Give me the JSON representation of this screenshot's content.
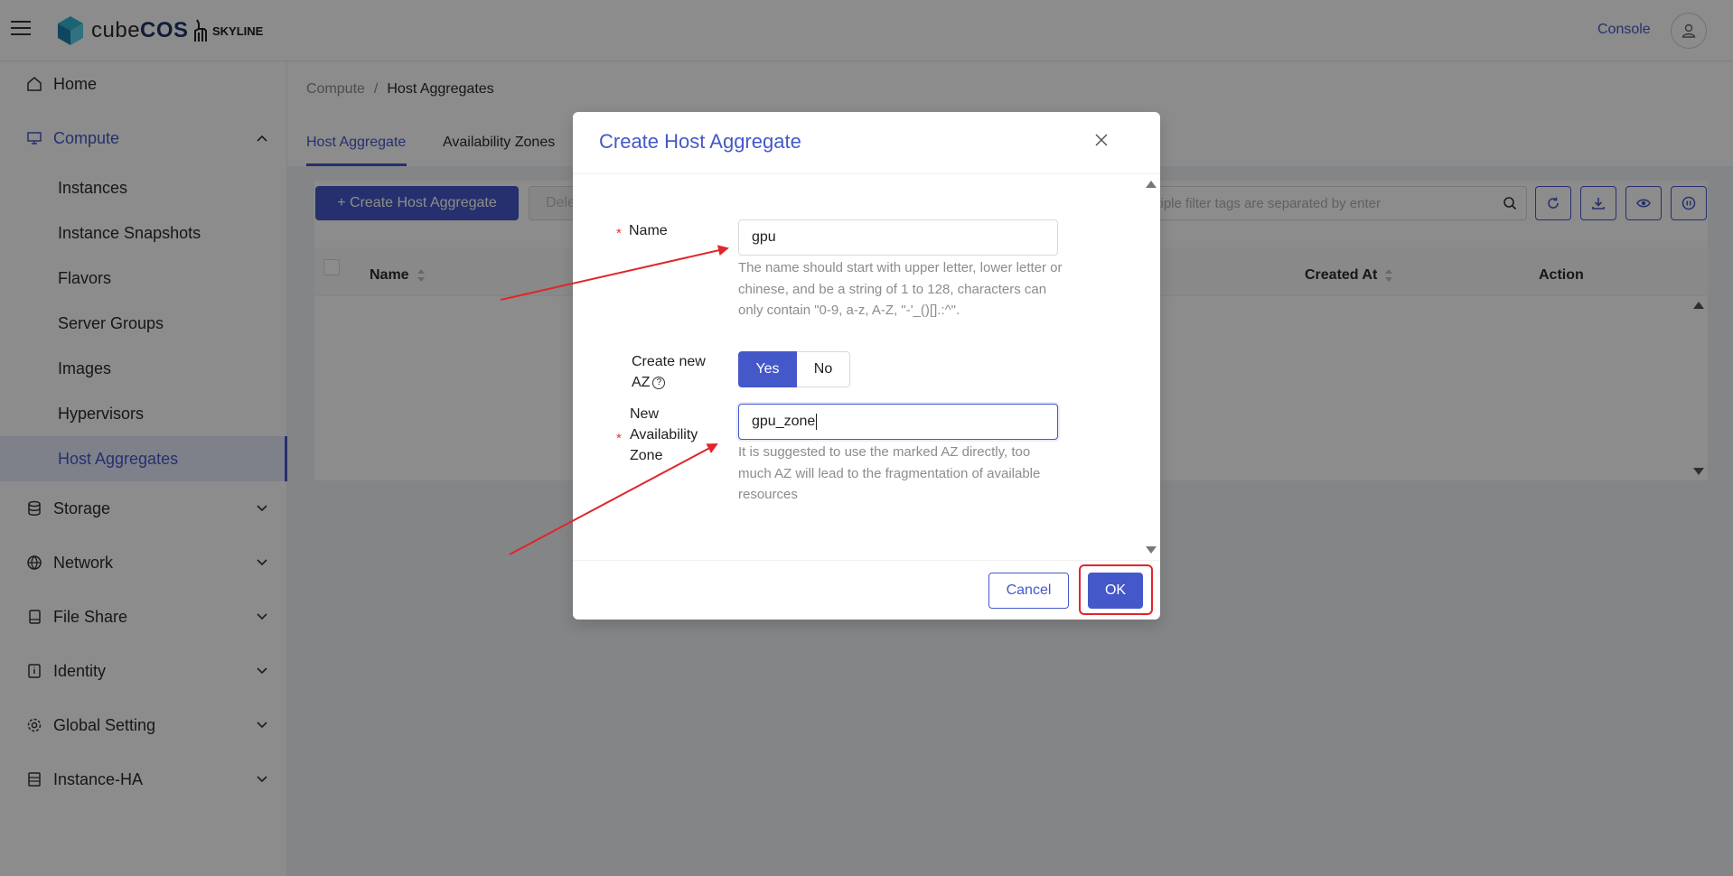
{
  "header": {
    "brand_prefix": "cube",
    "brand_suffix": "COS",
    "partner": "SKYLINE",
    "console_label": "Console"
  },
  "sidebar": {
    "items": [
      {
        "label": "Home",
        "icon": "home-icon"
      },
      {
        "label": "Compute",
        "icon": "monitor-icon",
        "expanded": true
      },
      {
        "label": "Storage",
        "icon": "database-icon"
      },
      {
        "label": "Network",
        "icon": "globe-icon"
      },
      {
        "label": "File Share",
        "icon": "file-icon"
      },
      {
        "label": "Identity",
        "icon": "id-card-icon"
      },
      {
        "label": "Global Setting",
        "icon": "gear-icon"
      },
      {
        "label": "Instance-HA",
        "icon": "server-icon"
      }
    ],
    "compute_children": [
      "Instances",
      "Instance Snapshots",
      "Flavors",
      "Server Groups",
      "Images",
      "Hypervisors",
      "Host Aggregates"
    ],
    "selected": "Host Aggregates"
  },
  "breadcrumb": {
    "parent": "Compute",
    "separator": "/",
    "current": "Host Aggregates"
  },
  "tabs": [
    "Host Aggregate",
    "Availability Zones"
  ],
  "toolbar": {
    "create_label": "+ Create Host Aggregate",
    "delete_label": "Dele",
    "search_placeholder": "ltiple filter tags are separated by enter"
  },
  "table": {
    "columns": [
      "Name",
      "Created At",
      "Action"
    ]
  },
  "modal": {
    "title": "Create Host Aggregate",
    "name_label": "Name",
    "name_value": "gpu",
    "name_help": "The name should start with upper letter, lower letter or chinese, and be a string of 1 to 128, characters can only contain \"0-9, a-z, A-Z, \"-'_()[].:^\".",
    "create_az_label_1": "Create new",
    "create_az_label_2": "AZ",
    "yes_label": "Yes",
    "no_label": "No",
    "new_az_label_1": "New",
    "new_az_label_2": "Availability",
    "new_az_label_3": "Zone",
    "new_az_value": "gpu_zone",
    "new_az_help": "It is suggested to use the marked AZ directly, too much AZ will lead to the fragmentation of available resources",
    "cancel_label": "Cancel",
    "ok_label": "OK"
  },
  "colors": {
    "accent": "#4558c9",
    "annotation": "#e0262a"
  }
}
